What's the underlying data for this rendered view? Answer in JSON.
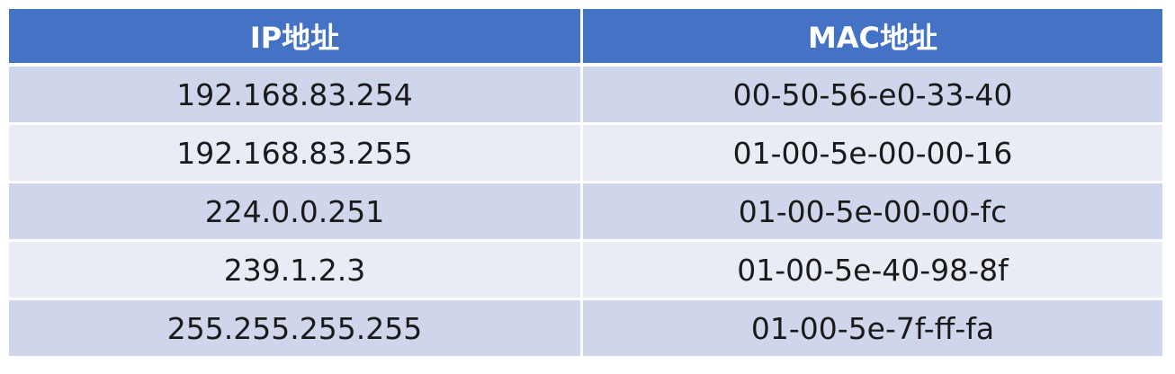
{
  "table": {
    "headers": [
      "IP地址",
      "MAC地址"
    ],
    "rows": [
      [
        "192.168.83.254",
        "00-50-56-e0-33-40"
      ],
      [
        "192.168.83.255",
        "01-00-5e-00-00-16"
      ],
      [
        "224.0.0.251",
        "01-00-5e-00-00-fc"
      ],
      [
        "239.1.2.3",
        "01-00-5e-40-98-8f"
      ],
      [
        "255.255.255.255",
        "01-00-5e-7f-ff-fa"
      ]
    ]
  },
  "colors": {
    "header_bg": "#4472c4",
    "header_text": "#ffffff",
    "row_odd_bg": "#cfd5ea",
    "row_even_bg": "#e9ebf5",
    "cell_text": "#1a1a1a"
  }
}
